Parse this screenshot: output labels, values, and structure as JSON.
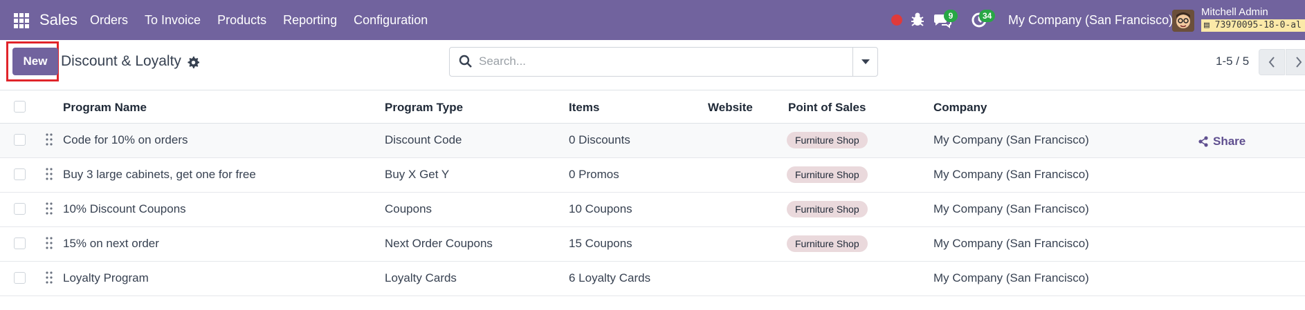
{
  "navbar": {
    "app_name": "Sales",
    "menu": [
      "Orders",
      "To Invoice",
      "Products",
      "Reporting",
      "Configuration"
    ],
    "chat_count": "9",
    "activity_count": "34",
    "company": "My Company (San Francisco)",
    "user_name": "Mitchell Admin",
    "db_name": "73970095-18-0-al"
  },
  "control": {
    "new_label": "New",
    "title": "Discount & Loyalty",
    "search_placeholder": "Search...",
    "pager": "1-5 / 5"
  },
  "table": {
    "headers": [
      "Program Name",
      "Program Type",
      "Items",
      "Website",
      "Point of Sales",
      "Company"
    ],
    "rows": [
      {
        "name": "Code for 10% on orders",
        "type": "Discount Code",
        "items": "0 Discounts",
        "website": "",
        "pos": "Furniture Shop",
        "company": "My Company (San Francisco)"
      },
      {
        "name": "Buy 3 large cabinets, get one for free",
        "type": "Buy X Get Y",
        "items": "0 Promos",
        "website": "",
        "pos": "Furniture Shop",
        "company": "My Company (San Francisco)"
      },
      {
        "name": "10% Discount Coupons",
        "type": "Coupons",
        "items": "10 Coupons",
        "website": "",
        "pos": "Furniture Shop",
        "company": "My Company (San Francisco)"
      },
      {
        "name": "15% on next order",
        "type": "Next Order Coupons",
        "items": "15 Coupons",
        "website": "",
        "pos": "Furniture Shop",
        "company": "My Company (San Francisco)"
      },
      {
        "name": "Loyalty Program",
        "type": "Loyalty Cards",
        "items": "6 Loyalty Cards",
        "website": "",
        "pos": "",
        "company": "My Company (San Francisco)"
      }
    ],
    "share_label": "Share"
  },
  "colors": {
    "brand": "#71639e",
    "badge": "#28a745",
    "tag": "#ead9dc",
    "highlight": "#e0242a"
  },
  "icons": [
    "apps-grid-icon",
    "record-dot-icon",
    "bug-icon",
    "chat-icon",
    "activity-clock-icon",
    "gear-icon",
    "search-icon",
    "caret-down-icon",
    "chevron-left-icon",
    "chevron-right-icon",
    "drag-handle-icon",
    "share-icon"
  ]
}
